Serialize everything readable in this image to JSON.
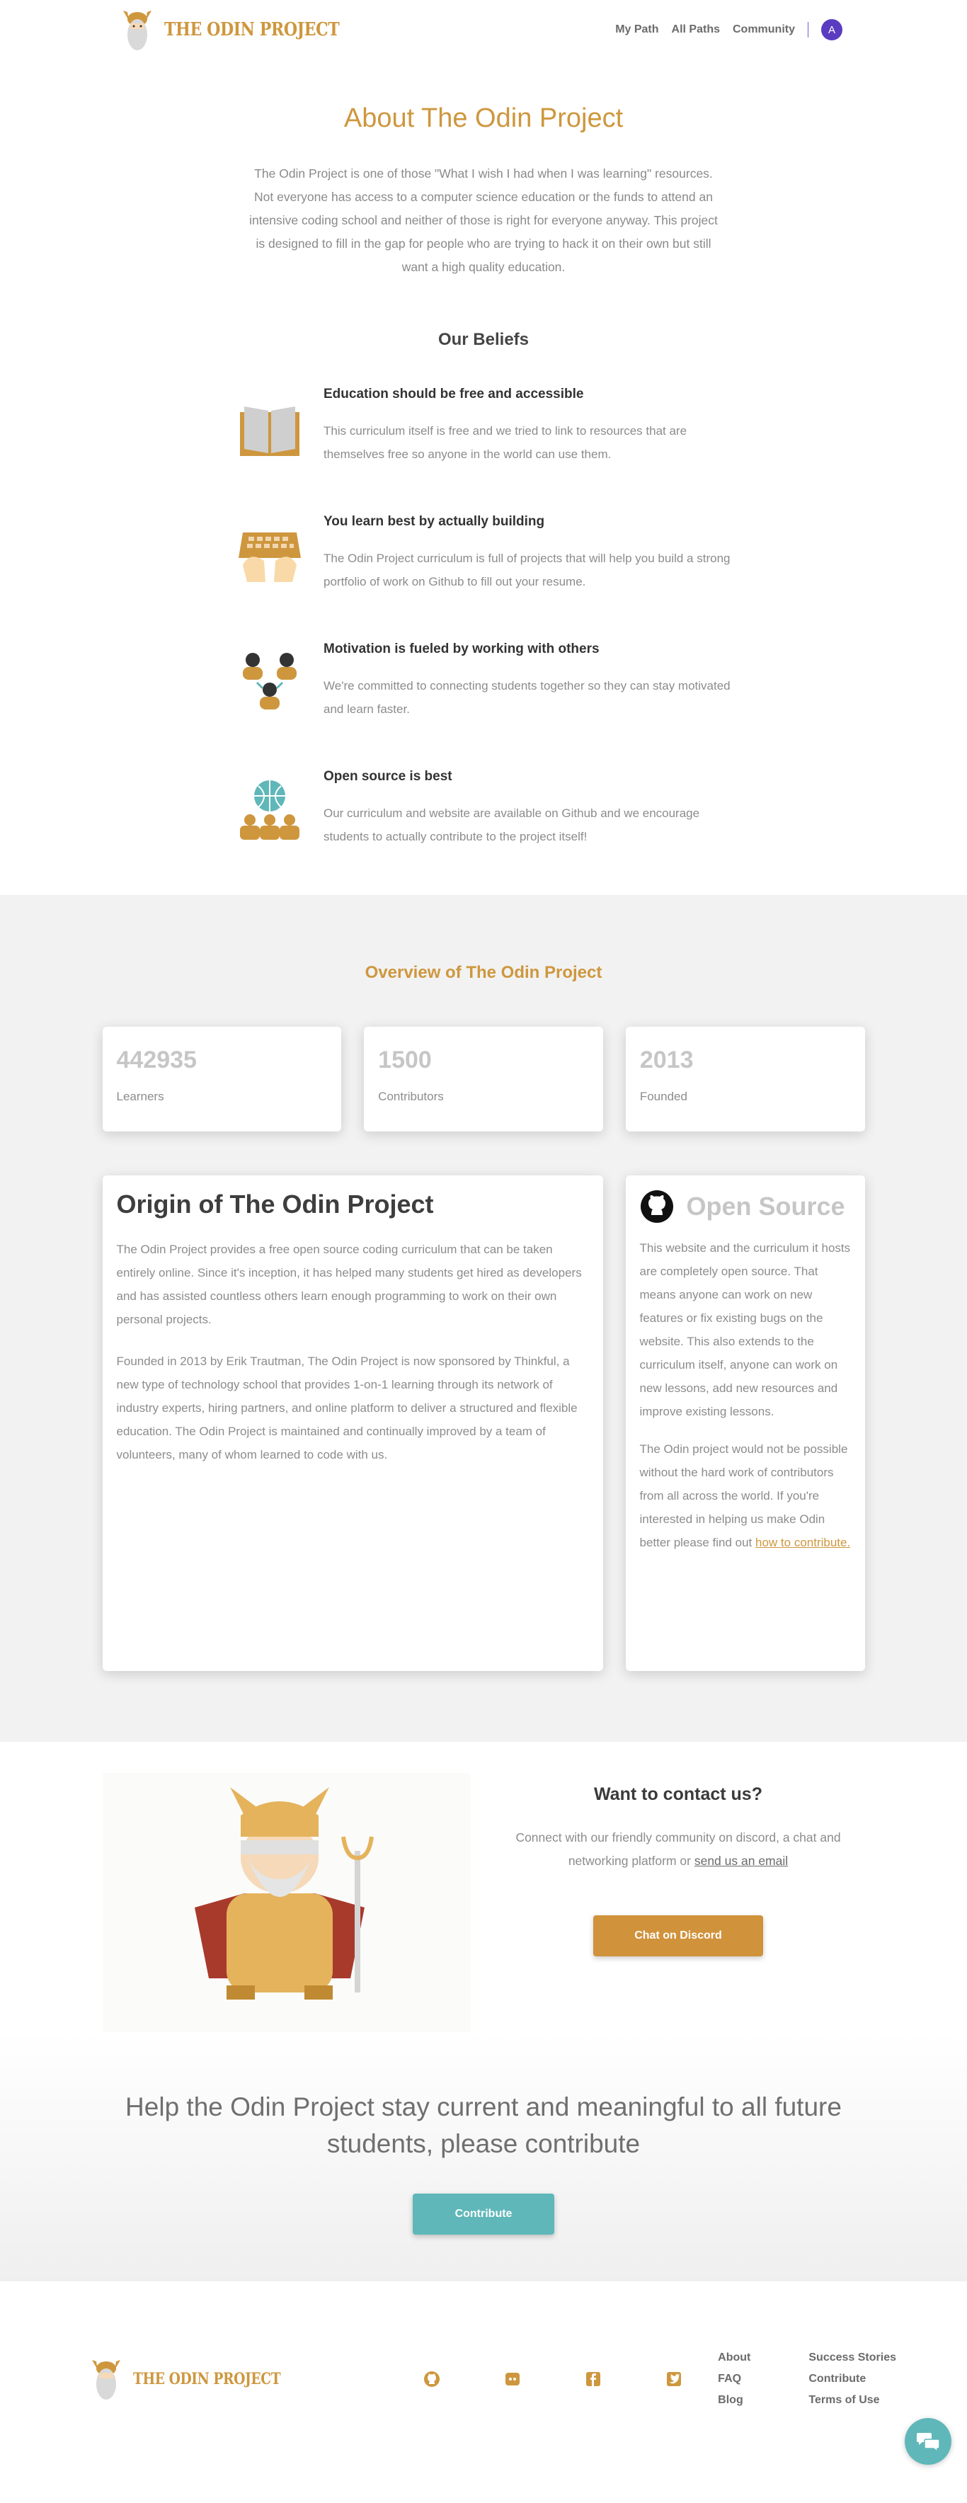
{
  "nav": {
    "brand": "THE ODIN PROJECT",
    "links": [
      "My Path",
      "All Paths",
      "Community"
    ],
    "avatar_initial": "A"
  },
  "about": {
    "title": "About The Odin Project",
    "text": "The Odin Project is one of those \"What I wish I had when I was learning\" resources. Not everyone has access to a computer science education or the funds to attend an intensive coding school and neither of those is right for everyone anyway. This project is designed to fill in the gap for people who are trying to hack it on their own but still want a high quality education.",
    "beliefs_title": "Our Beliefs"
  },
  "beliefs": [
    {
      "title": "Education should be free and accessible",
      "text": "This curriculum itself is free and we tried to link to resources that are themselves free so anyone in the world can use them.",
      "icon": "book-icon"
    },
    {
      "title": "You learn best by actually building",
      "text": "The Odin Project curriculum is full of projects that will help you build a strong portfolio of work on Github to fill out your resume.",
      "icon": "keyboard-hands-icon"
    },
    {
      "title": "Motivation is fueled by working with others",
      "text": "We're committed to connecting students together so they can stay motivated and learn faster.",
      "icon": "people-icon"
    },
    {
      "title": "Open source is best",
      "text": "Our curriculum and website are available on Github and we encourage students to actually contribute to the project itself!",
      "icon": "globe-people-icon"
    }
  ],
  "overview": {
    "title": "Overview of The Odin Project",
    "stats": [
      {
        "value": "442935",
        "label": "Learners"
      },
      {
        "value": "1500",
        "label": "Contributors"
      },
      {
        "value": "2013",
        "label": "Founded"
      }
    ]
  },
  "origin": {
    "title": "Origin of The Odin Project",
    "p1": "The Odin Project provides a free open source coding curriculum that can be taken entirely online. Since it's inception, it has helped many students get hired as developers and has assisted countless others learn enough programming to work on their own personal projects.",
    "p2": "Founded in 2013 by Erik Trautman, The Odin Project is now sponsored by Thinkful, a new type of technology school that provides 1-on-1 learning through its network of industry experts, hiring partners, and online platform to deliver a structured and flexible education. The Odin Project is maintained and continually improved by a team of volunteers, many of whom learned to code with us."
  },
  "open_source": {
    "title": "Open Source",
    "p1": "This website and the curriculum it hosts are completely open source. That means anyone can work on new features or fix existing bugs on the website. This also extends to the curriculum itself, anyone can work on new lessons, add new resources and improve existing lessons.",
    "p2": "The Odin project would not be possible without the hard work of contributors from all across the world. If you're interested in helping us make Odin better please find out",
    "link": "how to contribute."
  },
  "contact": {
    "title": "Want to contact us?",
    "text": "Connect with our friendly community on discord, a chat and networking platform or",
    "link": "send us an email",
    "button": "Chat on Discord"
  },
  "contribute": {
    "text": "Help the Odin Project stay current and meaningful to all future students, please contribute",
    "button": "Contribute"
  },
  "footer": {
    "brand": "THE ODIN PROJECT",
    "social": [
      "github-icon",
      "discord-icon",
      "facebook-icon",
      "twitter-icon"
    ],
    "col1": [
      "About",
      "FAQ",
      "Blog"
    ],
    "col2": [
      "Success Stories",
      "Contribute",
      "Terms of Use"
    ]
  },
  "colors": {
    "accent": "#ce973e",
    "teal": "#5fb7b9",
    "avatar": "#5a3cc0"
  }
}
